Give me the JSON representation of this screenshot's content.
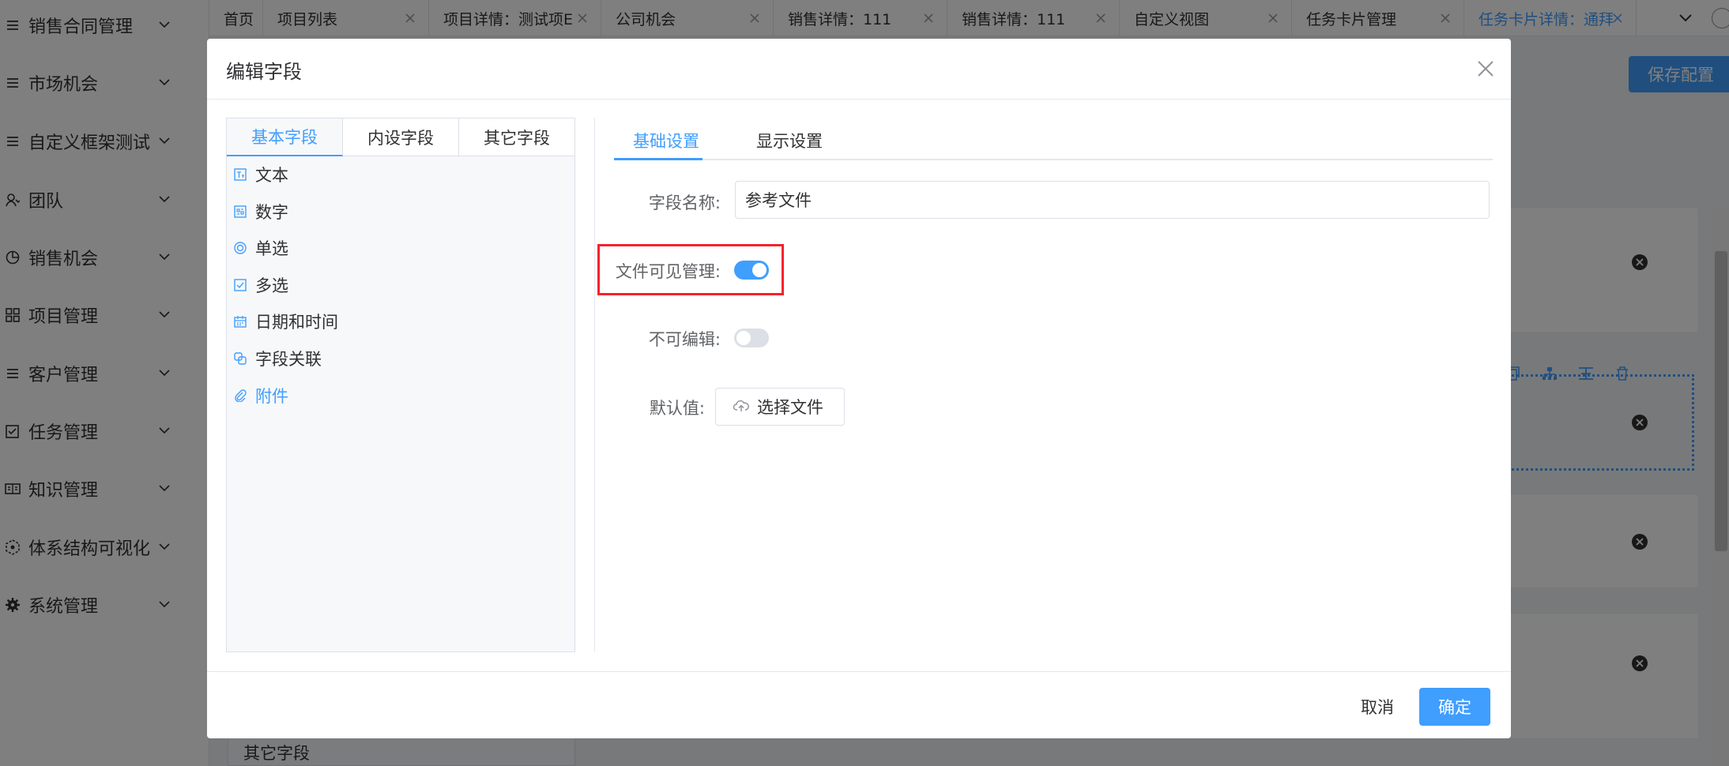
{
  "sidebar": {
    "items": [
      {
        "label": "销售合同管理",
        "icon": "menu-lines-icon"
      },
      {
        "label": "市场机会",
        "icon": "menu-lines-icon"
      },
      {
        "label": "自定义框架测试",
        "icon": "menu-lines-icon"
      },
      {
        "label": "团队",
        "icon": "team-icon"
      },
      {
        "label": "销售机会",
        "icon": "pie-chart-icon"
      },
      {
        "label": "项目管理",
        "icon": "grid-icon"
      },
      {
        "label": "客户管理",
        "icon": "menu-lines-icon"
      },
      {
        "label": "任务管理",
        "icon": "checkbox-icon"
      },
      {
        "label": "知识管理",
        "icon": "book-icon"
      },
      {
        "label": "体系结构可视化",
        "icon": "hexagon-nodes-icon"
      },
      {
        "label": "系统管理",
        "icon": "gear-icon"
      }
    ]
  },
  "tabs": {
    "items": [
      {
        "label": "首页"
      },
      {
        "label": "项目列表"
      },
      {
        "label": "项目详情：测试项E"
      },
      {
        "label": "公司机会"
      },
      {
        "label": "销售详情：111"
      },
      {
        "label": "销售详情：111"
      },
      {
        "label": "自定义视图"
      },
      {
        "label": "任务卡片管理"
      },
      {
        "label": "任务卡片详情：通拜"
      }
    ]
  },
  "background": {
    "save_config": "保存配置",
    "other_fields": "其它字段"
  },
  "dialog": {
    "title": "编辑字段",
    "field_tabs": [
      "基本字段",
      "内设字段",
      "其它字段"
    ],
    "field_items": [
      {
        "label": "文本",
        "icon": "text-field-icon"
      },
      {
        "label": "数字",
        "icon": "number-field-icon"
      },
      {
        "label": "单选",
        "icon": "radio-icon"
      },
      {
        "label": "多选",
        "icon": "checkbox-icon"
      },
      {
        "label": "日期和时间",
        "icon": "calendar-icon"
      },
      {
        "label": "字段关联",
        "icon": "link-boxes-icon"
      },
      {
        "label": "附件",
        "icon": "paperclip-icon"
      }
    ],
    "settings_tabs": [
      "基础设置",
      "显示设置"
    ],
    "form": {
      "name_label": "字段名称:",
      "name_value": "参考文件",
      "visible_label": "文件可见管理:",
      "visible_on": true,
      "readonly_label": "不可编辑:",
      "readonly_on": false,
      "default_label": "默认值:",
      "upload_label": "选择文件"
    },
    "cancel": "取消",
    "ok": "确定"
  },
  "colors": {
    "accent": "#409eff",
    "highlight": "#f5222d"
  }
}
